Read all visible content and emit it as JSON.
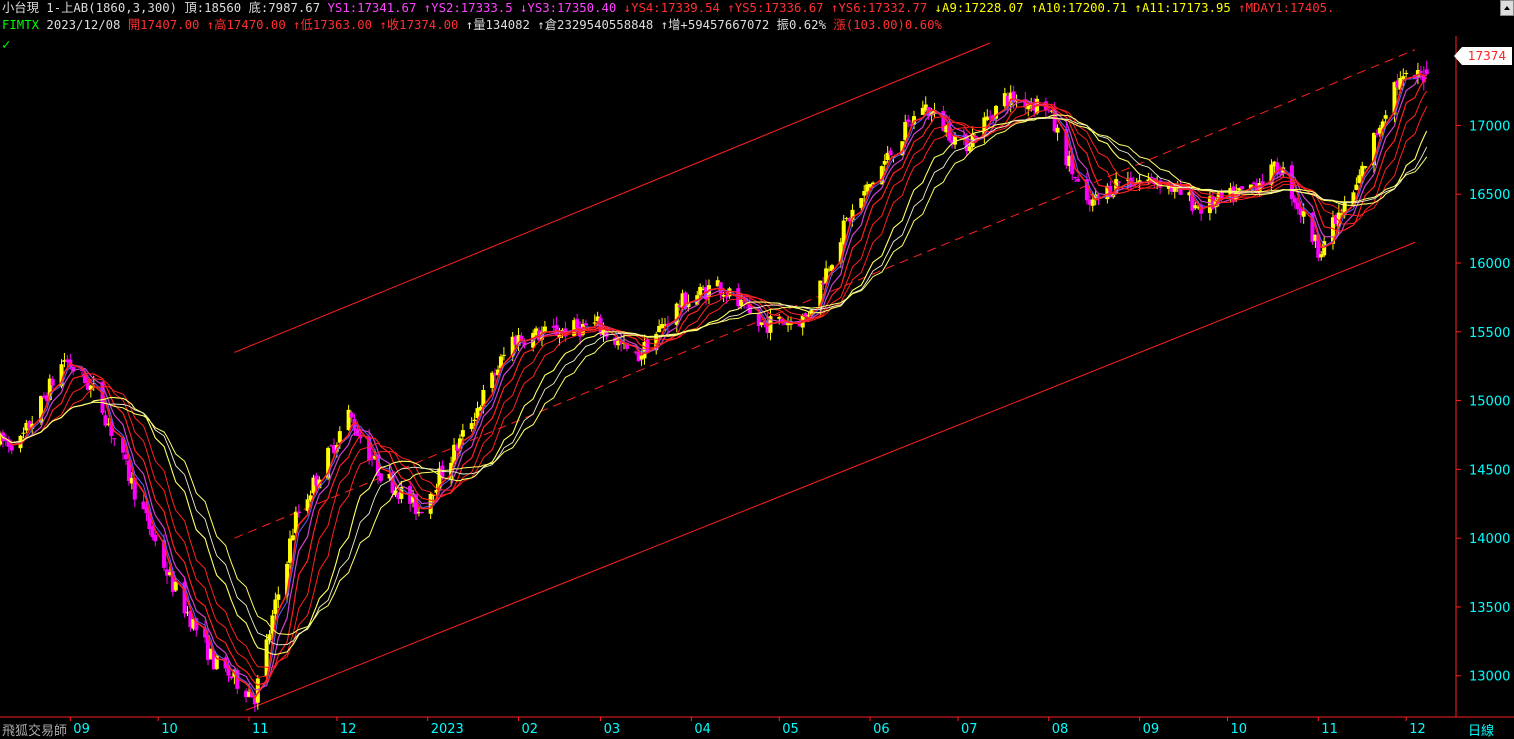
{
  "header": {
    "row1": [
      {
        "text": "小台現 1-上AB(1860,3,300)",
        "color": "#dddddd"
      },
      {
        "text": "頂:18560",
        "color": "#dddddd"
      },
      {
        "text": "底:7987.67",
        "color": "#dddddd"
      },
      {
        "text": "YS1:17341.67",
        "color": "#ff44ff"
      },
      {
        "text": "↑YS2:17333.5",
        "color": "#ff44ff"
      },
      {
        "text": "↓YS3:17350.40",
        "color": "#ff44ff"
      },
      {
        "text": "↓YS4:17339.54",
        "color": "#ff3030"
      },
      {
        "text": "↑YS5:17336.67",
        "color": "#ff3030"
      },
      {
        "text": "↑YS6:17332.77",
        "color": "#ff3030"
      },
      {
        "text": "↓A9:17228.07",
        "color": "#ffff00"
      },
      {
        "text": "↑A10:17200.71",
        "color": "#ffff00"
      },
      {
        "text": "↑A11:17173.95",
        "color": "#ffff00"
      },
      {
        "text": "↑MDAY1:17405.",
        "color": "#ff3030"
      }
    ],
    "row2": [
      {
        "text": "FIMTX",
        "color": "#00ff00"
      },
      {
        "text": "2023/12/08",
        "color": "#dddddd"
      },
      {
        "text": "開17407.00",
        "color": "#ff3030"
      },
      {
        "text": "↑高17470.00",
        "color": "#ff3030"
      },
      {
        "text": "↑低17363.00",
        "color": "#ff3030"
      },
      {
        "text": "↑收17374.00",
        "color": "#ff3030"
      },
      {
        "text": "↑量134082",
        "color": "#dddddd"
      },
      {
        "text": "↑倉2329540558848",
        "color": "#dddddd"
      },
      {
        "text": "↑增+59457667072",
        "color": "#dddddd"
      },
      {
        "text": "振0.62%",
        "color": "#dddddd"
      },
      {
        "text": "漲(103.00)0.60%",
        "color": "#ff3030"
      }
    ]
  },
  "checkmark": "✓",
  "brand": "飛狐交易師",
  "period_label": "日線",
  "current_price": "17374",
  "colors": {
    "background": "#000000",
    "axis": "#ff2020",
    "axis_text": "#00ffff",
    "bull_candle": "#ffff00",
    "bear_candle": "#ff00ff",
    "channel": "#ff2020",
    "ma_red": "#ff2020",
    "ma_yellow": "#ffff66",
    "ma_white": "#f0f0d0",
    "ma_magenta": "#d040d0",
    "ma_blue": "#6060ff"
  },
  "chart_data": {
    "type": "candlestick",
    "title": "小台現 1-上AB(1860,3,300)",
    "xlabel": "",
    "ylabel": "",
    "period": "日線",
    "ylim": [
      12700,
      17650
    ],
    "y_ticks": [
      13000,
      13500,
      14000,
      14500,
      15000,
      15500,
      16000,
      16500,
      17000
    ],
    "x_month_labels": [
      "09",
      "10",
      "11",
      "12",
      "2023",
      "02",
      "03",
      "04",
      "05",
      "06",
      "07",
      "08",
      "09",
      "10",
      "11",
      "12"
    ],
    "trend": [
      [
        "2022-08-15",
        14700
      ],
      [
        "2022-08-30",
        15300
      ],
      [
        "2022-09-10",
        15050
      ],
      [
        "2022-09-22",
        14400
      ],
      [
        "2022-10-05",
        13700
      ],
      [
        "2022-10-20",
        13100
      ],
      [
        "2022-11-03",
        12850
      ],
      [
        "2022-11-17",
        14150
      ],
      [
        "2022-11-28",
        14600
      ],
      [
        "2022-12-05",
        14900
      ],
      [
        "2022-12-15",
        14500
      ],
      [
        "2022-12-29",
        14200
      ],
      [
        "2023-01-12",
        14700
      ],
      [
        "2023-01-30",
        15450
      ],
      [
        "2023-02-14",
        15500
      ],
      [
        "2023-02-28",
        15550
      ],
      [
        "2023-03-13",
        15300
      ],
      [
        "2023-03-28",
        15700
      ],
      [
        "2023-04-10",
        15850
      ],
      [
        "2023-04-24",
        15550
      ],
      [
        "2023-05-10",
        15600
      ],
      [
        "2023-05-24",
        16300
      ],
      [
        "2023-06-08",
        16800
      ],
      [
        "2023-06-19",
        17150
      ],
      [
        "2023-07-03",
        16850
      ],
      [
        "2023-07-17",
        17200
      ],
      [
        "2023-07-31",
        17150
      ],
      [
        "2023-08-14",
        16400
      ],
      [
        "2023-08-25",
        16600
      ],
      [
        "2023-09-08",
        16600
      ],
      [
        "2023-09-22",
        16400
      ],
      [
        "2023-10-05",
        16500
      ],
      [
        "2023-10-19",
        16700
      ],
      [
        "2023-11-01",
        16100
      ],
      [
        "2023-11-13",
        16500
      ],
      [
        "2023-11-27",
        17300
      ],
      [
        "2023-12-08",
        17374
      ]
    ],
    "last_candle": {
      "date": "2023-12-08",
      "open": 17407,
      "high": 17470,
      "low": 17363,
      "close": 17374
    },
    "channel_lines": [
      {
        "style": "solid",
        "points": [
          [
            "2022-10-31",
            12750
          ],
          [
            "2023-12-04",
            16150
          ]
        ]
      },
      {
        "style": "dashed",
        "points": [
          [
            "2022-10-27",
            14000
          ],
          [
            "2023-12-04",
            17550
          ]
        ]
      },
      {
        "style": "solid",
        "points": [
          [
            "2022-10-27",
            15350
          ],
          [
            "2023-07-12",
            17600
          ]
        ]
      }
    ]
  }
}
